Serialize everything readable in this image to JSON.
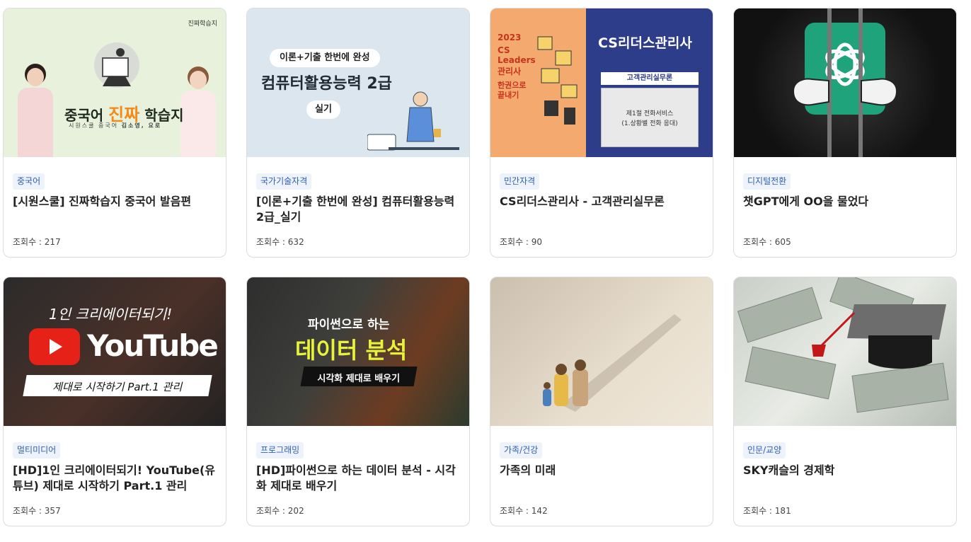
{
  "view_label": "조회수 : ",
  "cards": [
    {
      "category": "중국어",
      "title": "[시원스쿨] 진짜학습지 중국어 발음편",
      "views": "217",
      "thumb": {
        "headline_a": "중국어 ",
        "headline_b": "진짜",
        "headline_c": " 학습지",
        "sub": "시원스쿨 중국어",
        "names": "김소영, 요로",
        "logo": "진짜학습지"
      }
    },
    {
      "category": "국가기술자격",
      "title": "[이론+기출 한번에 완성] 컴퓨터활용능력 2급_실기",
      "views": "632",
      "thumb": {
        "pill": "이론+기출 한번에 완성",
        "headline": "컴퓨터활용능력 2급",
        "pill2": "실기"
      }
    },
    {
      "category": "민간자격",
      "title": "CS리더스관리사 - 고객관리실무론",
      "views": "90",
      "thumb": {
        "year": "2023",
        "cs": "CS",
        "leaders": "Leaders",
        "manager": "관리사",
        "one": "한권으로",
        "end": "끝내기",
        "headline": "CS리더스관리사",
        "box_title": "고객관리실무론",
        "box_line1": "제1절 전화서비스",
        "box_line2": "(1.상황별 전화 응대)"
      }
    },
    {
      "category": "디지털전환",
      "title": "챗GPT에게 OO을 물었다",
      "views": "605",
      "thumb": {}
    },
    {
      "category": "멀티미디어",
      "title": "[HD]1인 크리에이터되기! YouTube(유튜브) 제대로 시작하기 Part.1 관리",
      "views": "357",
      "thumb": {
        "top": "1인 크리에이터되기!",
        "brand": "YouTube",
        "bottom": "제대로 시작하기 Part.1 관리"
      }
    },
    {
      "category": "프로그래밍",
      "title": "[HD]파이썬으로 하는 데이터 분석 - 시각화 제대로 배우기",
      "views": "202",
      "thumb": {
        "top": "파이썬으로 하는",
        "headline": "데이터 분석",
        "sub": "시각화 제대로 배우기"
      }
    },
    {
      "category": "가족/건강",
      "title": "가족의 미래",
      "views": "142",
      "thumb": {}
    },
    {
      "category": "인문/교양",
      "title": "SKY캐슬의 경제학",
      "views": "181",
      "thumb": {}
    }
  ]
}
